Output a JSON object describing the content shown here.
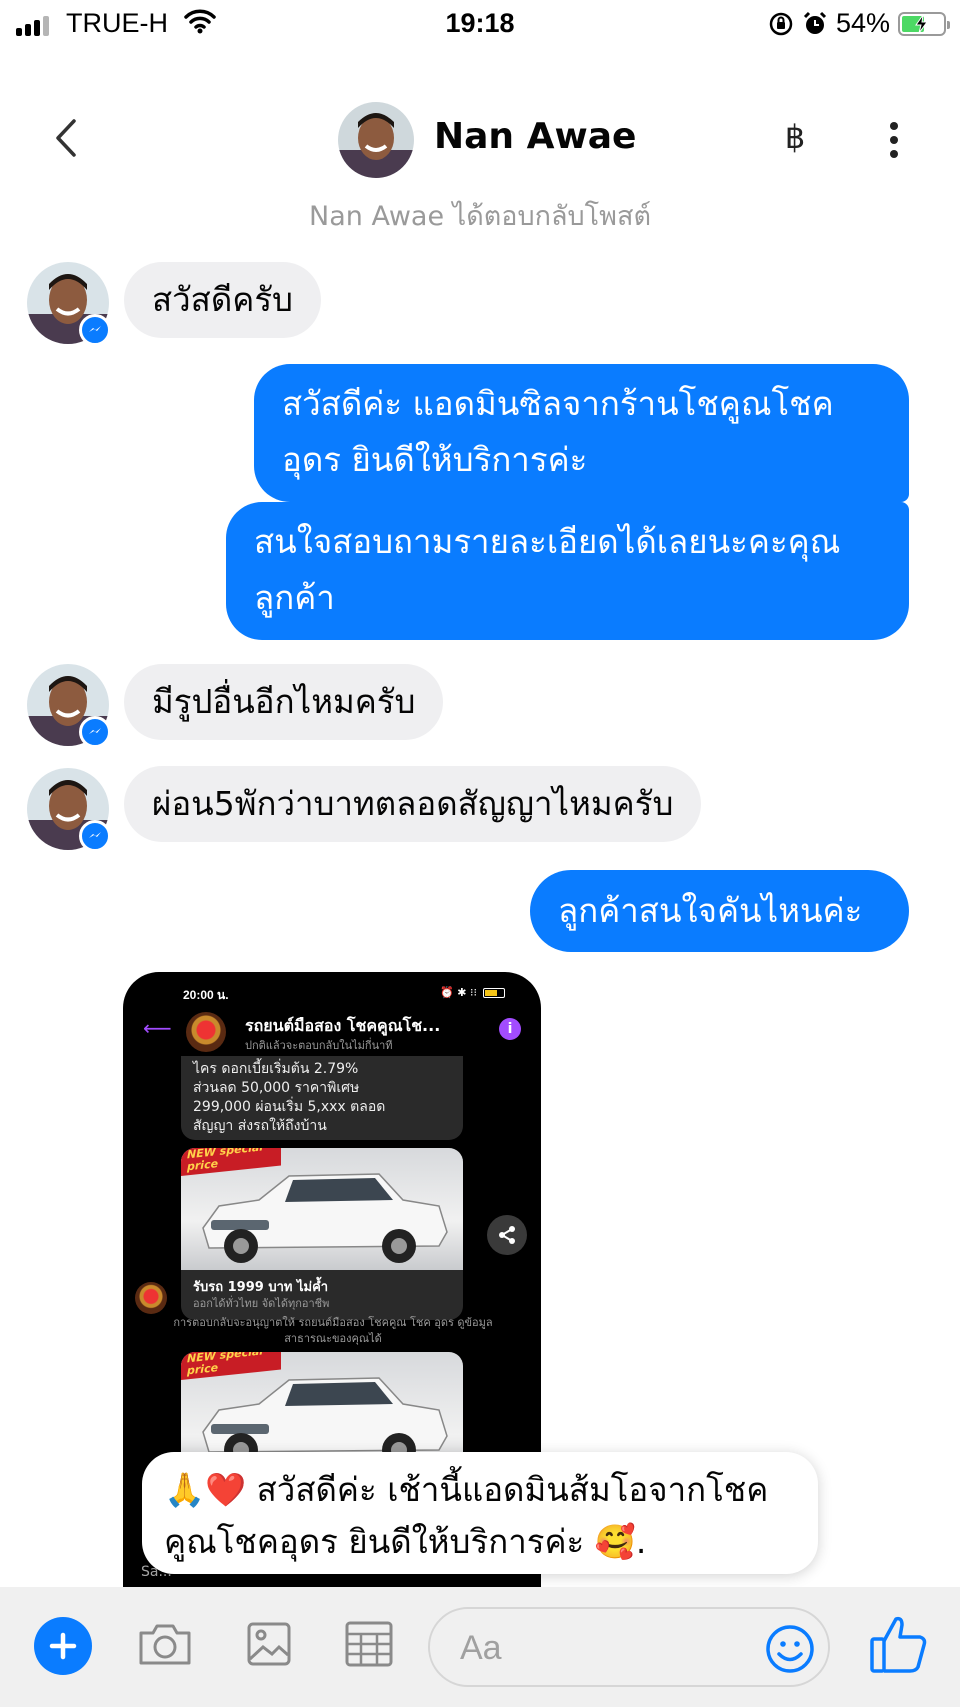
{
  "status_bar": {
    "carrier": "TRUE-H",
    "time": "19:18",
    "battery_percent": "54%",
    "battery_level": 0.54,
    "icons": [
      "signal-icon",
      "wifi-icon",
      "orientation-lock-icon",
      "alarm-icon",
      "battery-charging-icon"
    ]
  },
  "header": {
    "name": "Nan Awae",
    "baht_label": "฿",
    "icons": [
      "back-chevron-icon",
      "more-vertical-icon"
    ]
  },
  "context_note": "Nan Awae ได้ตอบกลับโพสต์",
  "messages": {
    "m1": "สวัสดีครับ",
    "m2_line1": "สวัสดีค่ะ แอดมินซิลจากร้านโชคูณโชค",
    "m2_line2": "อุดร ยินดีให้บริการค่ะ",
    "m3_line1": "สนใจสอบถามรายละเอียดได้เลยนะคะคุณ",
    "m3_line2": "ลูกค้า",
    "m4": "มีรูปอื่นอีกไหมครับ",
    "m5": "ผ่อน5พักว่าบาทตลอดสัญญาไหมครับ",
    "m6": "ลูกค้าสนใจคันไหนค่ะ"
  },
  "shared_image": {
    "status_time": "20:00 น.",
    "page_title": "รถยนต์มือสอง โชคคูณโช...",
    "page_subtitle": "ปกติแล้วจะตอบกลับในไม่กี่นาที",
    "promo_lines": [
      "ไคร ดอกเบี้ยเริ่มต้น 2.79%",
      "ส่วนลด 50,000 ราคาพิเศษ",
      "299,000 ผ่อนเริ่ม 5,xxx ตลอด",
      "สัญญา ส่งรถให้ถึงบ้าน"
    ],
    "sticker_text": "NEW special price",
    "card_title": "รับรถ 1999 บาท ไม่ค้ำ",
    "card_subtitle": "ออกได้ทั่วไทย จัดได้ทุกอาชีพ",
    "system_note": "การตอบกลับจะอนุญาตให้ รถยนต์มือสอง โชคคูณ โชค อุดร ดูข้อมูลสาธารณะของคุณได้",
    "bottom_text": "Sa..."
  },
  "overlay_message": {
    "line1": "🙏❤️ สวัสดีค่ะ เช้านี้แอดมินส้มโอจากโชค",
    "line2": "คูณโชคอุดร ยินดีให้บริการค่ะ 🥰."
  },
  "composer": {
    "placeholder": "Aa",
    "icons": [
      "plus-icon",
      "camera-icon",
      "image-icon",
      "sticker-grid-icon",
      "emoji-icon",
      "thumbs-up-icon"
    ]
  },
  "colors": {
    "messenger_blue": "#0a7cff",
    "incoming_bubble": "#efeff1",
    "muted_text": "#9a9a9a"
  }
}
